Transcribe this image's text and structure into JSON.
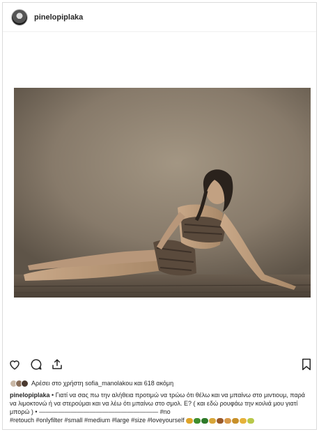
{
  "post": {
    "username": "pinelopiplaka"
  },
  "likes": {
    "text": "Αρέσει στο χρήστη sofia_manolakou και 618 ακόμη"
  },
  "caption": {
    "username": "pinelopiplaka",
    "text": "• Γιατί να σας πω την αλήθεια προτιμώ να τρώω ότι θέλω και να μπαίνω στο μιντιουμ, παρά να λιμοκτονώ ή να στερούμαι και να λέω ότι μπαίνω στο σμολ. Ε? ( και εδώ ρουφάω την κοιλιά μου γιατί μπορώ ) • ——————————————————— #no",
    "hashtags": "#retouch #onlyfilter #small #medium #large #size #loveyourself"
  },
  "icons": {
    "like": "heart-icon",
    "comment": "comment-icon",
    "share": "share-icon",
    "save": "bookmark-icon"
  },
  "colors": {
    "text": "#262626",
    "border": "#dbdbdb",
    "photo_wall": "#8a7e70"
  }
}
